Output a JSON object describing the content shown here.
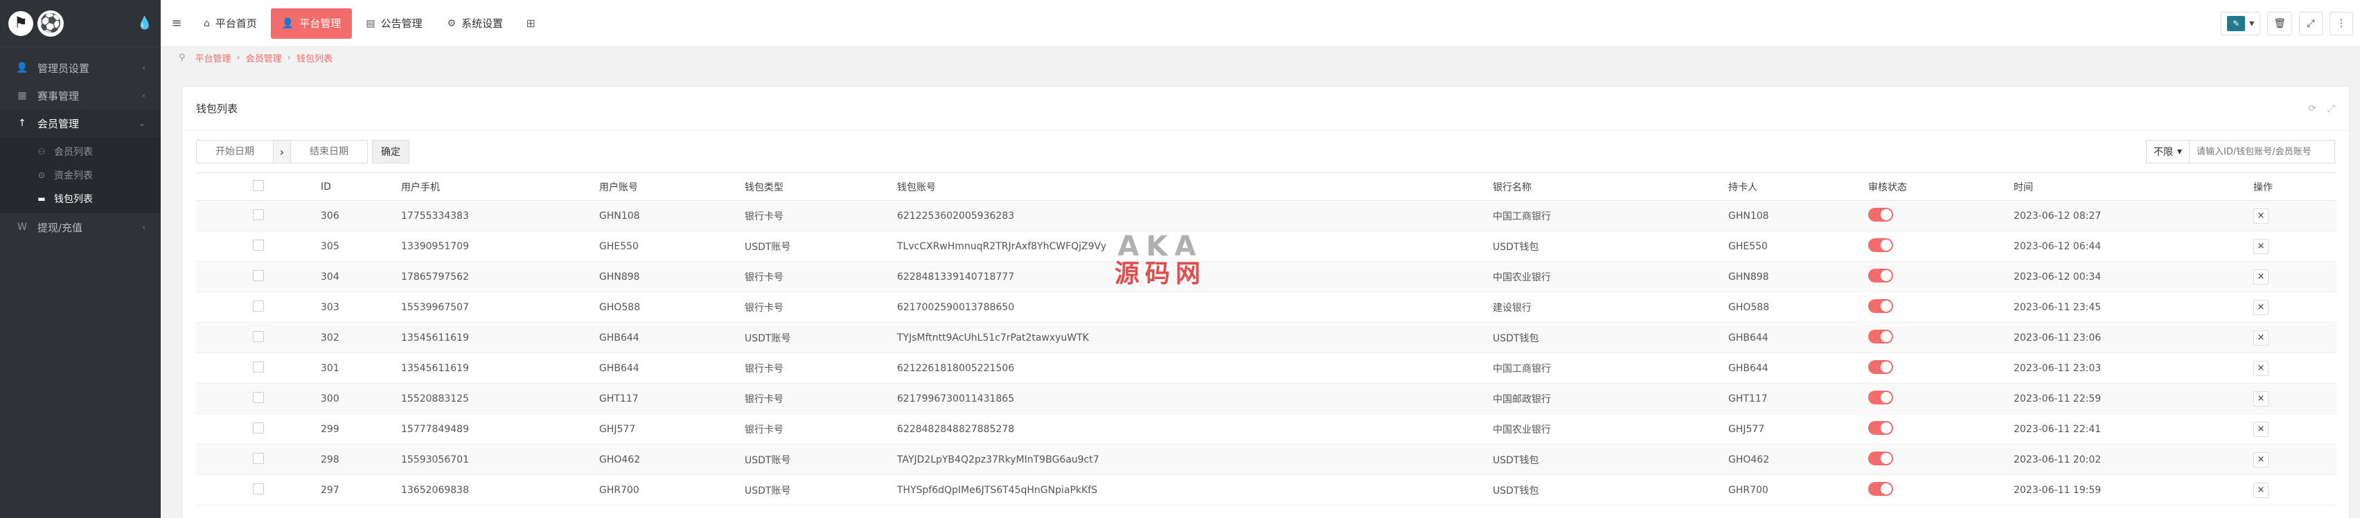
{
  "sidebar": {
    "logo_icon": "football-icon",
    "menu": [
      {
        "label": "管理员设置",
        "icon": "user-icon",
        "open": false
      },
      {
        "label": "赛事管理",
        "icon": "trophy-icon",
        "open": false
      },
      {
        "label": "会员管理",
        "icon": "member-icon",
        "open": true,
        "children": [
          {
            "label": "会员列表",
            "active": false
          },
          {
            "label": "资金列表",
            "active": false
          },
          {
            "label": "钱包列表",
            "active": true
          }
        ]
      },
      {
        "label": "提现/充值",
        "icon": "wallet-icon",
        "open": false
      }
    ]
  },
  "topbar": {
    "tabs": [
      {
        "label": "平台首页",
        "icon": "home-icon",
        "active": false
      },
      {
        "label": "平台管理",
        "icon": "user-icon",
        "active": true
      },
      {
        "label": "公告管理",
        "icon": "doc-icon",
        "active": false
      },
      {
        "label": "系统设置",
        "icon": "gear-icon",
        "active": false
      }
    ]
  },
  "breadcrumb": [
    "平台管理",
    "会员管理",
    "钱包列表"
  ],
  "panel": {
    "title": "钱包列表",
    "filter": {
      "start_placeholder": "开始日期",
      "end_placeholder": "结束日期",
      "confirm_label": "确定",
      "limit_label": "不限",
      "search_placeholder": "请输入ID/钱包账号/会员账号"
    },
    "columns": [
      "ID",
      "用户手机",
      "用户账号",
      "钱包类型",
      "钱包账号",
      "银行名称",
      "持卡人",
      "审核状态",
      "时间",
      "操作"
    ],
    "rows": [
      {
        "id": "306",
        "phone": "17755334383",
        "account": "GHN108",
        "type": "银行卡号",
        "wallet": "6212253602005936283",
        "bank": "中国工商银行",
        "holder": "GHN108",
        "time": "2023-06-12 08:27"
      },
      {
        "id": "305",
        "phone": "13390951709",
        "account": "GHE550",
        "type": "USDT账号",
        "wallet": "TLvcCXRwHmnuqR2TRJrAxf8YhCWFQjZ9Vy",
        "bank": "USDT钱包",
        "holder": "GHE550",
        "time": "2023-06-12 06:44"
      },
      {
        "id": "304",
        "phone": "17865797562",
        "account": "GHN898",
        "type": "银行卡号",
        "wallet": "6228481339140718777",
        "bank": "中国农业银行",
        "holder": "GHN898",
        "time": "2023-06-12 00:34"
      },
      {
        "id": "303",
        "phone": "15539967507",
        "account": "GHO588",
        "type": "银行卡号",
        "wallet": "6217002590013788650",
        "bank": "建设银行",
        "holder": "GHO588",
        "time": "2023-06-11 23:45"
      },
      {
        "id": "302",
        "phone": "13545611619",
        "account": "GHB644",
        "type": "USDT账号",
        "wallet": "TYJsMftntt9AcUhL51c7rPat2tawxyuWTK",
        "bank": "USDT钱包",
        "holder": "GHB644",
        "time": "2023-06-11 23:06"
      },
      {
        "id": "301",
        "phone": "13545611619",
        "account": "GHB644",
        "type": "银行卡号",
        "wallet": "6212261818005221506",
        "bank": "中国工商银行",
        "holder": "GHB644",
        "time": "2023-06-11 23:03"
      },
      {
        "id": "300",
        "phone": "15520883125",
        "account": "GHT117",
        "type": "银行卡号",
        "wallet": "6217996730011431865",
        "bank": "中国邮政银行",
        "holder": "GHT117",
        "time": "2023-06-11 22:59"
      },
      {
        "id": "299",
        "phone": "15777849489",
        "account": "GHJ577",
        "type": "银行卡号",
        "wallet": "6228482848827885278",
        "bank": "中国农业银行",
        "holder": "GHJ577",
        "time": "2023-06-11 22:41"
      },
      {
        "id": "298",
        "phone": "15593056701",
        "account": "GHO462",
        "type": "USDT账号",
        "wallet": "TAYJD2LpYB4Q2pz37RkyMInT9BG6au9ct7",
        "bank": "USDT钱包",
        "holder": "GHO462",
        "time": "2023-06-11 20:02"
      },
      {
        "id": "297",
        "phone": "13652069838",
        "account": "GHR700",
        "type": "USDT账号",
        "wallet": "THYSpf6dQpIMe6JTS6T45qHnGNpiaPkKfS",
        "bank": "USDT钱包",
        "holder": "GHR700",
        "time": "2023-06-11 19:59"
      }
    ],
    "delete_glyph": "×"
  },
  "watermark": {
    "top": "AKA",
    "bottom": "源码网"
  }
}
